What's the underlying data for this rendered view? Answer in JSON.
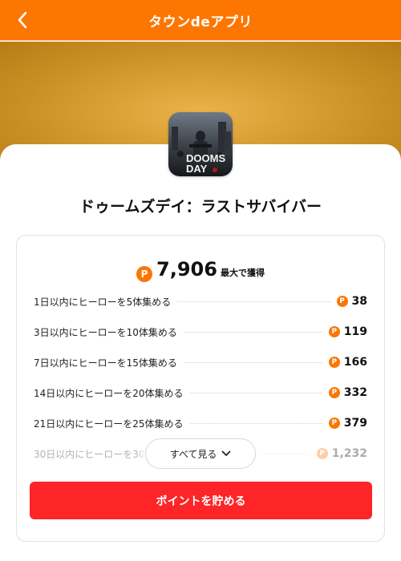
{
  "header": {
    "title": "タウンdeアプリ",
    "back_icon": "chevron-left-icon"
  },
  "colors": {
    "header": "#fd7601",
    "cta": "#fd2527",
    "coin": "#fd7601"
  },
  "app": {
    "name": "ドゥームズデイ：ラストサバイバー",
    "icon_text_line1": "DOOMS",
    "icon_text_line2": "DAY"
  },
  "points": {
    "coin_glyph": "P",
    "total": "7,906",
    "total_suffix": "最大で獲得",
    "missions": [
      {
        "label": "1日以内にヒーローを5体集める",
        "points": "38"
      },
      {
        "label": "3日以内にヒーローを10体集める",
        "points": "119"
      },
      {
        "label": "7日以内にヒーローを15体集める",
        "points": "166"
      },
      {
        "label": "14日以内にヒーローを20体集める",
        "points": "332"
      },
      {
        "label": "21日以内にヒーローを25体集める",
        "points": "379"
      },
      {
        "label": "30日以内にヒーローを30体集める",
        "points": "1,232"
      }
    ]
  },
  "see_all": {
    "label": "すべて見る",
    "icon": "chevron-down-icon"
  },
  "cta": {
    "label": "ポイントを貯める"
  }
}
